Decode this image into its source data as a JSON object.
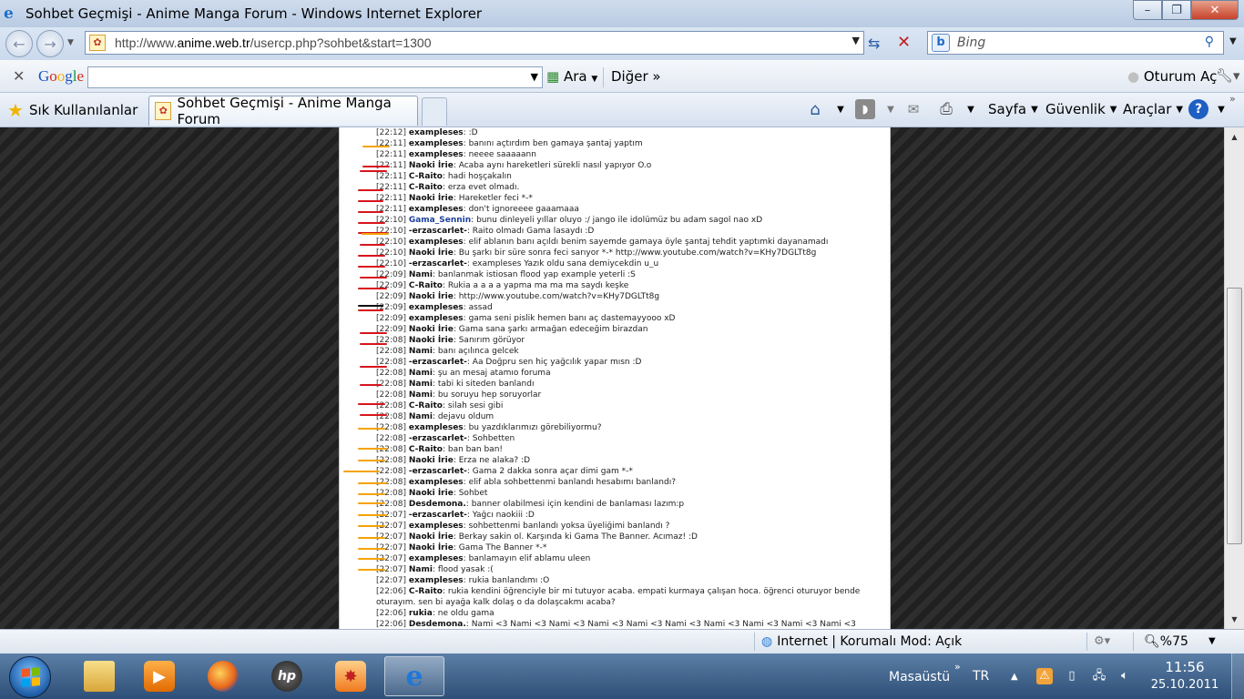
{
  "window": {
    "title": "Sohbet Geçmişi - Anime Manga Forum - Windows Internet Explorer",
    "buttons": {
      "minimize": "–",
      "maximize": "❐",
      "close": "✕"
    }
  },
  "address_bar": {
    "url_prefix": "http://www.",
    "url_domain": "anime.web.tr",
    "url_path": "/usercp.php?sohbet&start=1300",
    "search_placeholder": "Bing"
  },
  "google_toolbar": {
    "logo": "Google",
    "search_label": "Ara",
    "more_label": "Diğer »",
    "login_label": "Oturum Aç"
  },
  "command_bar": {
    "favorites_label": "Sık Kullanılanlar",
    "tab_title": "Sohbet Geçmişi - Anime Manga Forum",
    "menus": [
      "Sayfa",
      "Güvenlik",
      "Araçlar"
    ]
  },
  "chat": [
    {
      "time": "[22:12]",
      "user": "exampleses",
      "msg": ":D"
    },
    {
      "time": "[22:11]",
      "user": "exampleses",
      "msg": "banını açtırdım ben gamaya şantaj yaptım"
    },
    {
      "time": "[22:11]",
      "user": "exampleses",
      "msg": "neeee saaaaann"
    },
    {
      "time": "[22:11]",
      "user": "Naoki İrie",
      "msg": "Acaba aynı hareketleri sürekli nasıl yapıyor O.o"
    },
    {
      "time": "[22:11]",
      "user": "C-Raito",
      "msg": "hadi hoşçakalın"
    },
    {
      "time": "[22:11]",
      "user": "C-Raito",
      "msg": "erza evet olmadı."
    },
    {
      "time": "[22:11]",
      "user": "Naoki İrie",
      "msg": "Hareketler feci *-*"
    },
    {
      "time": "[22:11]",
      "user": "exampleses",
      "msg": "don't ignoreeee gaaamaaa"
    },
    {
      "time": "[22:10]",
      "user": "Gama_Sennin",
      "msg": "bunu dinleyeli yıllar oluyo :/ jango ile idolümüz bu adam sagol nao xD",
      "blue": true
    },
    {
      "time": "[22:10]",
      "user": "-erzascarlet-",
      "msg": "Raito olmadı Gama lasaydı :D"
    },
    {
      "time": "[22:10]",
      "user": "exampleses",
      "msg": "elif ablanın banı açıldı benim sayemde gamaya öyle şantaj tehdit yaptımki dayanamadı"
    },
    {
      "time": "[22:10]",
      "user": "Naoki İrie",
      "msg": "Bu şarkı bir süre sonra feci sarıyor *-* http://www.youtube.com/watch?v=KHy7DGLTt8g"
    },
    {
      "time": "[22:10]",
      "user": "-erzascarlet-",
      "msg": "exampleses Yazık oldu sana demiycekdin u_u"
    },
    {
      "time": "[22:09]",
      "user": "Nami",
      "msg": "banlanmak istiosan flood yap example yeterli :S"
    },
    {
      "time": "[22:09]",
      "user": "C-Raito",
      "msg": "Rukia a a a a yapma ma ma ma saydı keşke"
    },
    {
      "time": "[22:09]",
      "user": "Naoki İrie",
      "msg": "http://www.youtube.com/watch?v=KHy7DGLTt8g"
    },
    {
      "time": "[22:09]",
      "user": "exampleses",
      "msg": "assad"
    },
    {
      "time": "[22:09]",
      "user": "exampleses",
      "msg": "gama seni pislik hemen banı aç dastemayyooo xD"
    },
    {
      "time": "[22:09]",
      "user": "Naoki İrie",
      "msg": "Gama sana şarkı armağan edeceğim birazdan"
    },
    {
      "time": "[22:08]",
      "user": "Naoki İrie",
      "msg": "Sanırım görüyor"
    },
    {
      "time": "[22:08]",
      "user": "Nami",
      "msg": "banı açılınca gelcek"
    },
    {
      "time": "[22:08]",
      "user": "-erzascarlet-",
      "msg": "Aa Doğpru sen hiç yağcılık yapar mısn :D"
    },
    {
      "time": "[22:08]",
      "user": "Nami",
      "msg": "şu an mesaj atamıo foruma"
    },
    {
      "time": "[22:08]",
      "user": "Nami",
      "msg": "tabi ki siteden banlandı"
    },
    {
      "time": "[22:08]",
      "user": "Nami",
      "msg": "bu soruyu hep soruyorlar"
    },
    {
      "time": "[22:08]",
      "user": "C-Raito",
      "msg": "silah sesi gibi"
    },
    {
      "time": "[22:08]",
      "user": "Nami",
      "msg": "dejavu oldum"
    },
    {
      "time": "[22:08]",
      "user": "exampleses",
      "msg": "bu yazdıklarımızı görebiliyormu?"
    },
    {
      "time": "[22:08]",
      "user": "-erzascarlet-",
      "msg": "Sohbetten"
    },
    {
      "time": "[22:08]",
      "user": "C-Raito",
      "msg": "ban ban ban!"
    },
    {
      "time": "[22:08]",
      "user": "Naoki İrie",
      "msg": "Erza ne alaka? :D"
    },
    {
      "time": "[22:08]",
      "user": "-erzascarlet-",
      "msg": "Gama 2 dakka sonra açar dimi gam *-*"
    },
    {
      "time": "[22:08]",
      "user": "exampleses",
      "msg": "elif abla sohbettenmi banlandı hesabımı banlandı?"
    },
    {
      "time": "[22:08]",
      "user": "Naoki İrie",
      "msg": "Sohbet"
    },
    {
      "time": "[22:08]",
      "user": "Desdemona.",
      "msg": "banner olabilmesi için kendini de banlaması lazım:p"
    },
    {
      "time": "[22:07]",
      "user": "-erzascarlet-",
      "msg": "Yağcı naokiii :D"
    },
    {
      "time": "[22:07]",
      "user": "exampleses",
      "msg": "sohbettenmi banlandı yoksa üyeliğimi banlandı ?"
    },
    {
      "time": "[22:07]",
      "user": "Naoki İrie",
      "msg": "Berkay sakin ol. Karşında ki Gama The Banner. Acımaz! :D"
    },
    {
      "time": "[22:07]",
      "user": "Naoki İrie",
      "msg": "Gama The Banner *-*"
    },
    {
      "time": "[22:07]",
      "user": "exampleses",
      "msg": "banlamayın elif ablamu uleen"
    },
    {
      "time": "[22:07]",
      "user": "Nami",
      "msg": "flood yasak :("
    },
    {
      "time": "[22:07]",
      "user": "exampleses",
      "msg": "rukia banlandımı :O"
    },
    {
      "time": "[22:06]",
      "user": "C-Raito",
      "msg": "rukia kendini öğrenciyle bir mi tutuyor acaba. empati kurmaya çalışan hoca. öğrenci oturuyor bende oturayım. sen bi ayağa kalk dolaş o da dolaşcakmı acaba?",
      "wrap": true
    },
    {
      "time": "[22:06]",
      "user": "rukia",
      "msg": "ne oldu gama"
    },
    {
      "time": "[22:06]",
      "user": "Desdemona.",
      "msg": "Nami <3 Nami <3 Nami <3 Nami <3 Nami <3 Nami <3 Nami <3 Nami <3 Nami <3 Nami <3"
    }
  ],
  "status_bar": {
    "zone": "Internet | Korumalı Mod: Açık",
    "zoom": "%75"
  },
  "taskbar": {
    "desktop_label": "Masaüstü",
    "lang": "TR",
    "time": "11:56",
    "date": "25.10.2011"
  },
  "colors": {
    "marker_red": "#d8141c",
    "marker_orange": "#f5a300",
    "marker_black": "#111111"
  }
}
